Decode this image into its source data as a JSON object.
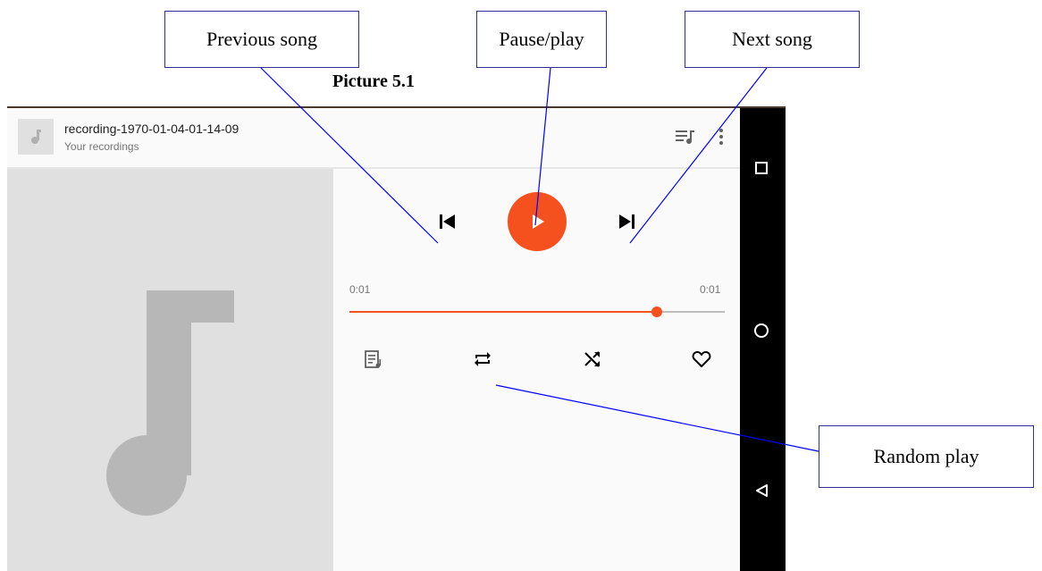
{
  "figure": {
    "caption": "Picture 5.1"
  },
  "callouts": {
    "previous": "Previous song",
    "play": "Pause/play",
    "next": "Next song",
    "random": "Random play"
  },
  "player": {
    "track_title": "recording-1970-01-04-01-14-09",
    "track_subtitle": "Your recordings",
    "elapsed": "0:01",
    "duration": "0:01",
    "progress_fraction": 0.82
  },
  "icons": {
    "thumbnail": "music-note-icon",
    "queue": "queue-music-icon",
    "overflow": "more-vert-icon",
    "previous": "skip-previous-icon",
    "play": "play-icon",
    "next": "skip-next-icon",
    "lyrics": "lyrics-icon",
    "repeat": "repeat-icon",
    "shuffle": "shuffle-icon",
    "favorite": "heart-icon",
    "nav_recents": "square-icon",
    "nav_home": "circle-icon",
    "nav_back": "triangle-back-icon"
  },
  "colors": {
    "accent": "#f4511e",
    "callout_border": "#2e3192",
    "leader_line": "#0000ff",
    "navbar": "#000000",
    "art_background": "#e0e0e0",
    "note_glyph": "#b7b7b7"
  }
}
